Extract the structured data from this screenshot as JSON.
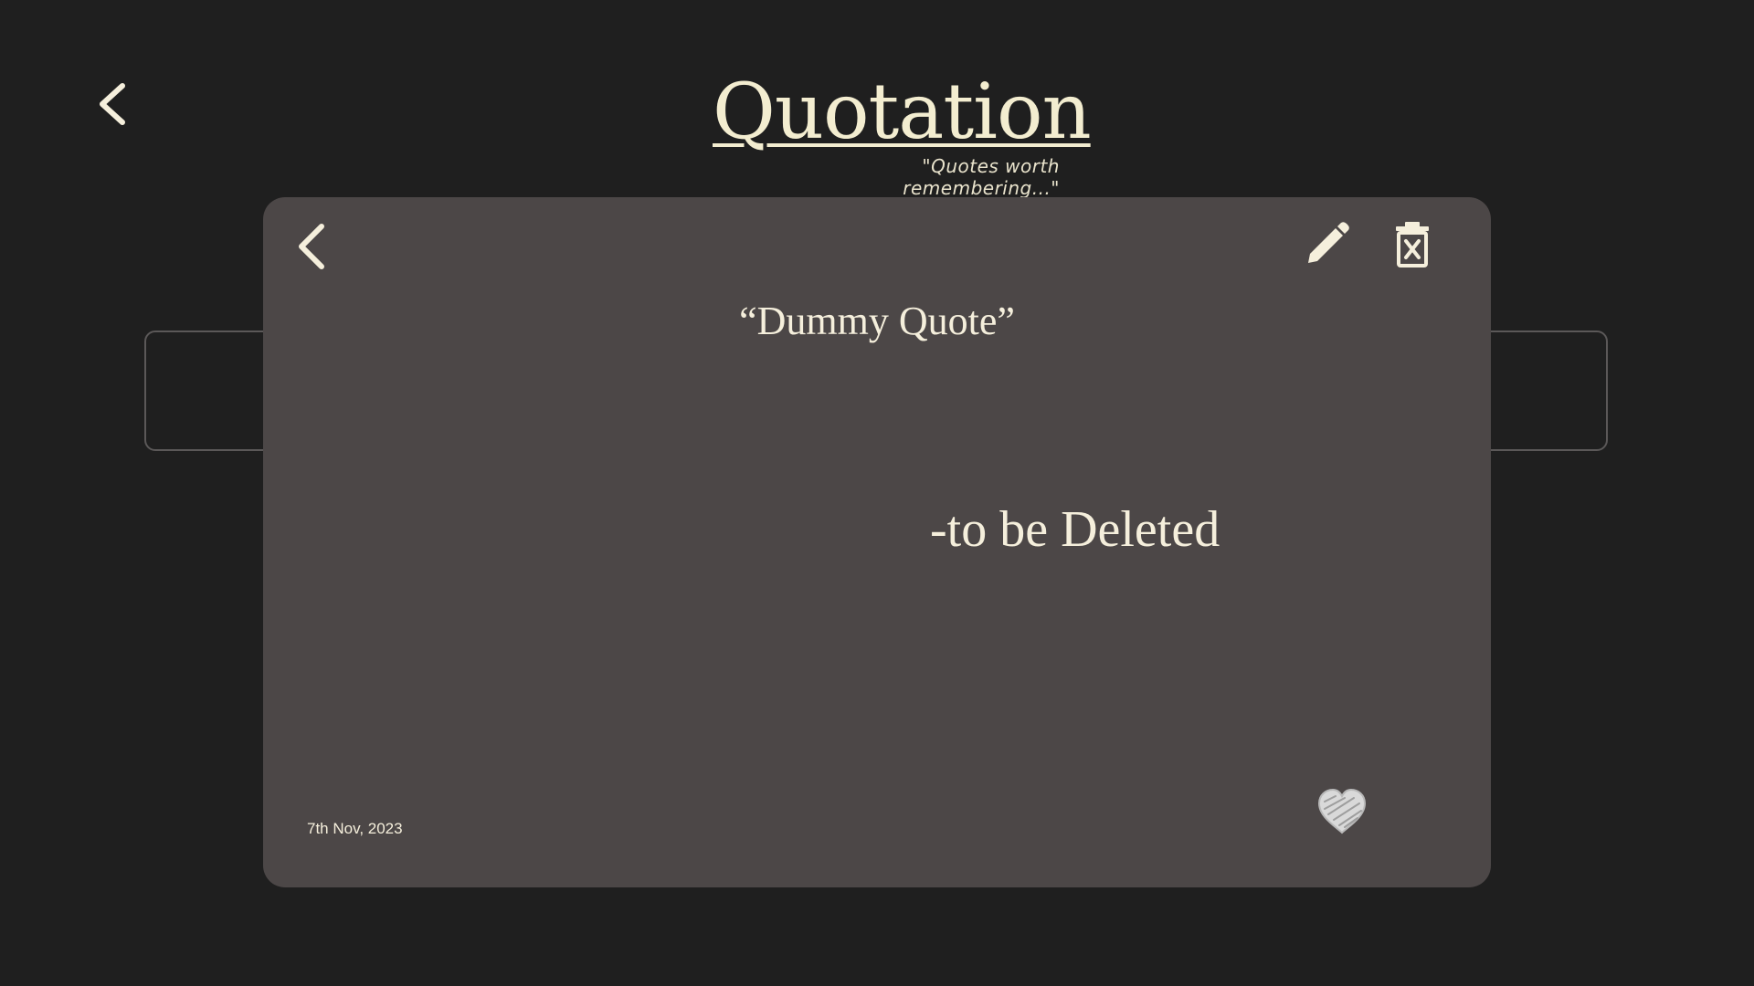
{
  "app": {
    "title": "Quotation",
    "subtitle": "\"Quotes worth remembering...\""
  },
  "icons": {
    "page_back": "chevron-left-icon",
    "modal_back": "chevron-left-icon",
    "edit": "pencil-icon",
    "delete": "trash-x-icon",
    "favorite": "heart-icon"
  },
  "quote": {
    "text": "“Dummy Quote”",
    "author": "-to be Deleted",
    "date": "7th Nov, 2023"
  },
  "colors": {
    "background": "#1f1f1f",
    "modal": "#4c4747",
    "text": "#f5efdc",
    "heart": "#d9d9d9"
  }
}
